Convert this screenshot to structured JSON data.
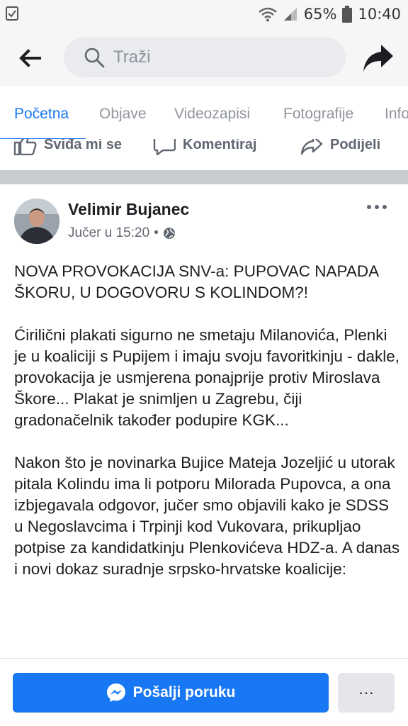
{
  "status_bar": {
    "battery_percent": "65%",
    "time": "10:40"
  },
  "search": {
    "placeholder": "Traži"
  },
  "tabs": [
    {
      "label": "Početna"
    },
    {
      "label": "Objave"
    },
    {
      "label": "Videozapisi"
    },
    {
      "label": "Fotografije"
    },
    {
      "label": "Info"
    }
  ],
  "actions": {
    "like": "Sviđa mi se",
    "comment": "Komentiraj",
    "share": "Podijeli"
  },
  "post": {
    "author": "Velimir Bujanec",
    "time": "Jučer u 15:20",
    "separator": "•",
    "paragraphs": [
      "NOVA PROVOKACIJA SNV-a: PUPOVAC NAPADA ŠKORU, U DOGOVORU S KOLINDOM?!",
      "Ćirilični plakati sigurno ne smetaju Milanovića, Plenki je u koaliciji s Pupijem i imaju svoju favoritkinju - dakle, provokacija je usmjerena ponajprije protiv Miroslava Škore... Plakat je snimljen u Zagrebu, čiji gradonačelnik također podupire KGK...",
      "Nakon što je novinarka Bujice Mateja Jozeljić u utorak pitala Kolindu ima li potporu Milorada Pupovca, a ona izbjegavala odgovor, jučer smo objavili kako je SDSS u Negoslavcima i Trpinji kod Vukovara, prikupljao potpise za kandidatkinju Plenkovićeva HDZ-a. A danas i novi dokaz suradnje srpsko-hrvatske koalicije:"
    ]
  },
  "bottom": {
    "message_button": "Pošalji poruku",
    "more_button": "···"
  },
  "colors": {
    "accent": "#1877f2",
    "separator": "#c9ccd1"
  }
}
